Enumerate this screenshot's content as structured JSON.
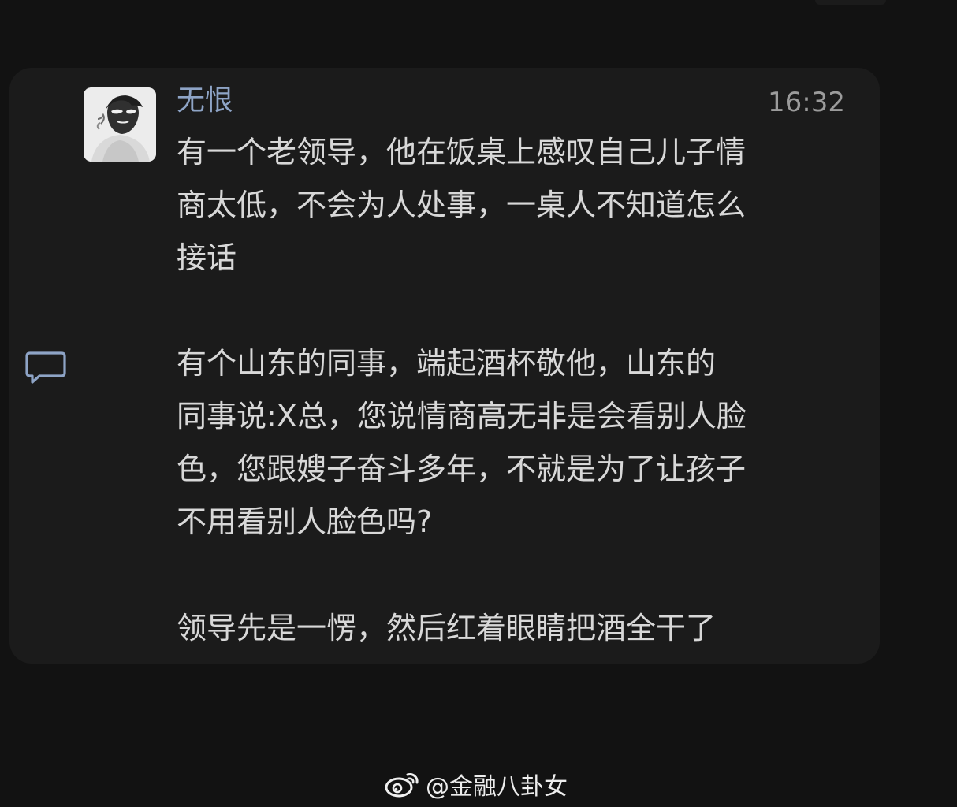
{
  "message": {
    "author": "无恨",
    "time": "16:32",
    "paragraphs": [
      {
        "lines": [
          "有一个老领导，他在饭桌上感叹自己儿子情",
          "商太低，不会为人处事，一桌人不知道怎么",
          "接话"
        ]
      },
      {
        "lines": [
          "有个山东的同事，端起酒杯敬他，山东的",
          "同事说:X总，您说情商高无非是会看别人脸",
          "色，您跟嫂子奋斗多年，不就是为了让孩子",
          "不用看别人脸色吗?"
        ]
      },
      {
        "lines": [
          "领导先是一愣，然后红着眼睛把酒全干了"
        ]
      }
    ]
  },
  "watermark": {
    "text": "@金融八卦女"
  },
  "icons": {
    "avatar": "avatar-illustration",
    "comment": "comment-bubble-icon",
    "watermark": "weibo-logo-icon"
  },
  "colors": {
    "background": "#121212",
    "card": "#1b1b1b",
    "author": "#8ea4c6",
    "text": "#d8d8d8",
    "time": "#9b9b9b",
    "icon": "#8ea4c6"
  }
}
